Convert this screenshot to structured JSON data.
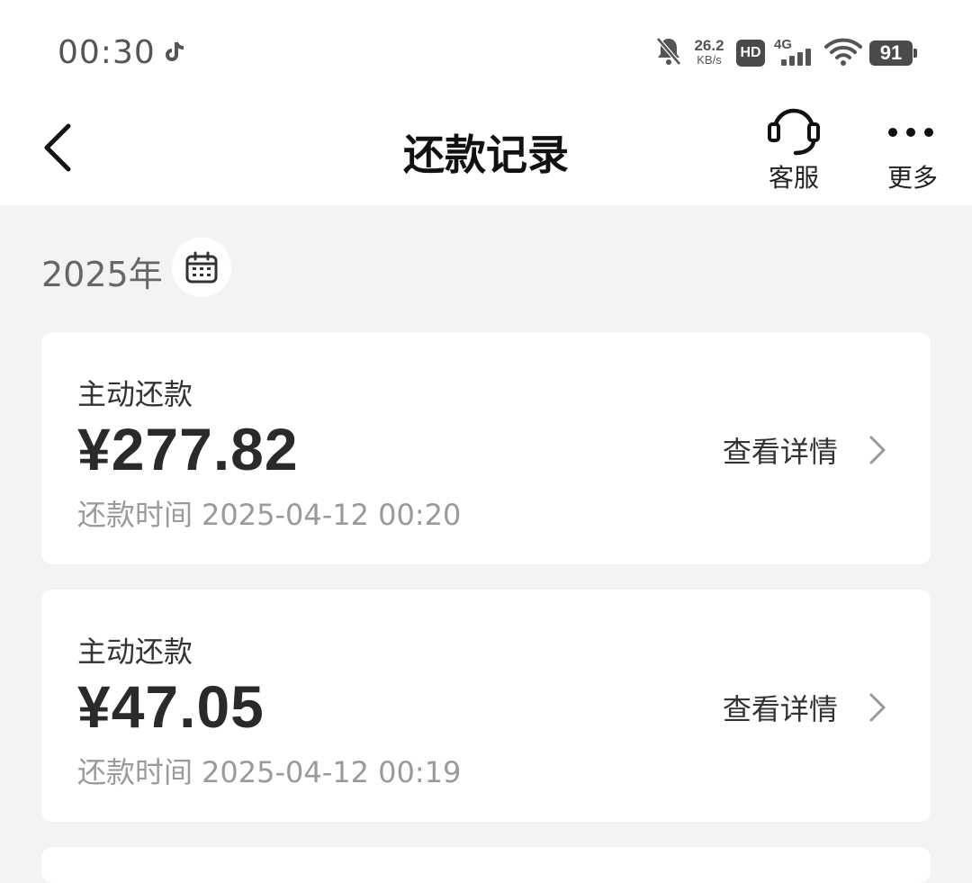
{
  "status_bar": {
    "time": "00:30",
    "net_speed_value": "26.2",
    "net_speed_unit": "KB/s",
    "hd_label": "HD",
    "network_type": "4G",
    "battery_level": "91",
    "icons": [
      "tiktok-icon",
      "bell-muted-icon",
      "hd-icon",
      "signal-icon",
      "wifi-icon",
      "battery-icon"
    ]
  },
  "header": {
    "title": "还款记录",
    "back_icon": "chevron-left-icon",
    "actions": [
      {
        "label": "客服",
        "icon": "headset-icon"
      },
      {
        "label": "更多",
        "icon": "more-dots-icon"
      }
    ]
  },
  "year_filter": {
    "label": "2025年",
    "icon": "calendar-icon"
  },
  "records": [
    {
      "type": "主动还款",
      "amount": "¥277.82",
      "time_label": "还款时间",
      "time": "2025-04-12 00:20",
      "detail_label": "查看详情"
    },
    {
      "type": "主动还款",
      "amount": "¥47.05",
      "time_label": "还款时间",
      "time": "2025-04-12 00:19",
      "detail_label": "查看详情"
    }
  ],
  "colors": {
    "page_background": "#f2f3f5",
    "card_background": "#ffffff",
    "text_primary": "#2a2a2a",
    "text_secondary": "#9a9a9a"
  }
}
